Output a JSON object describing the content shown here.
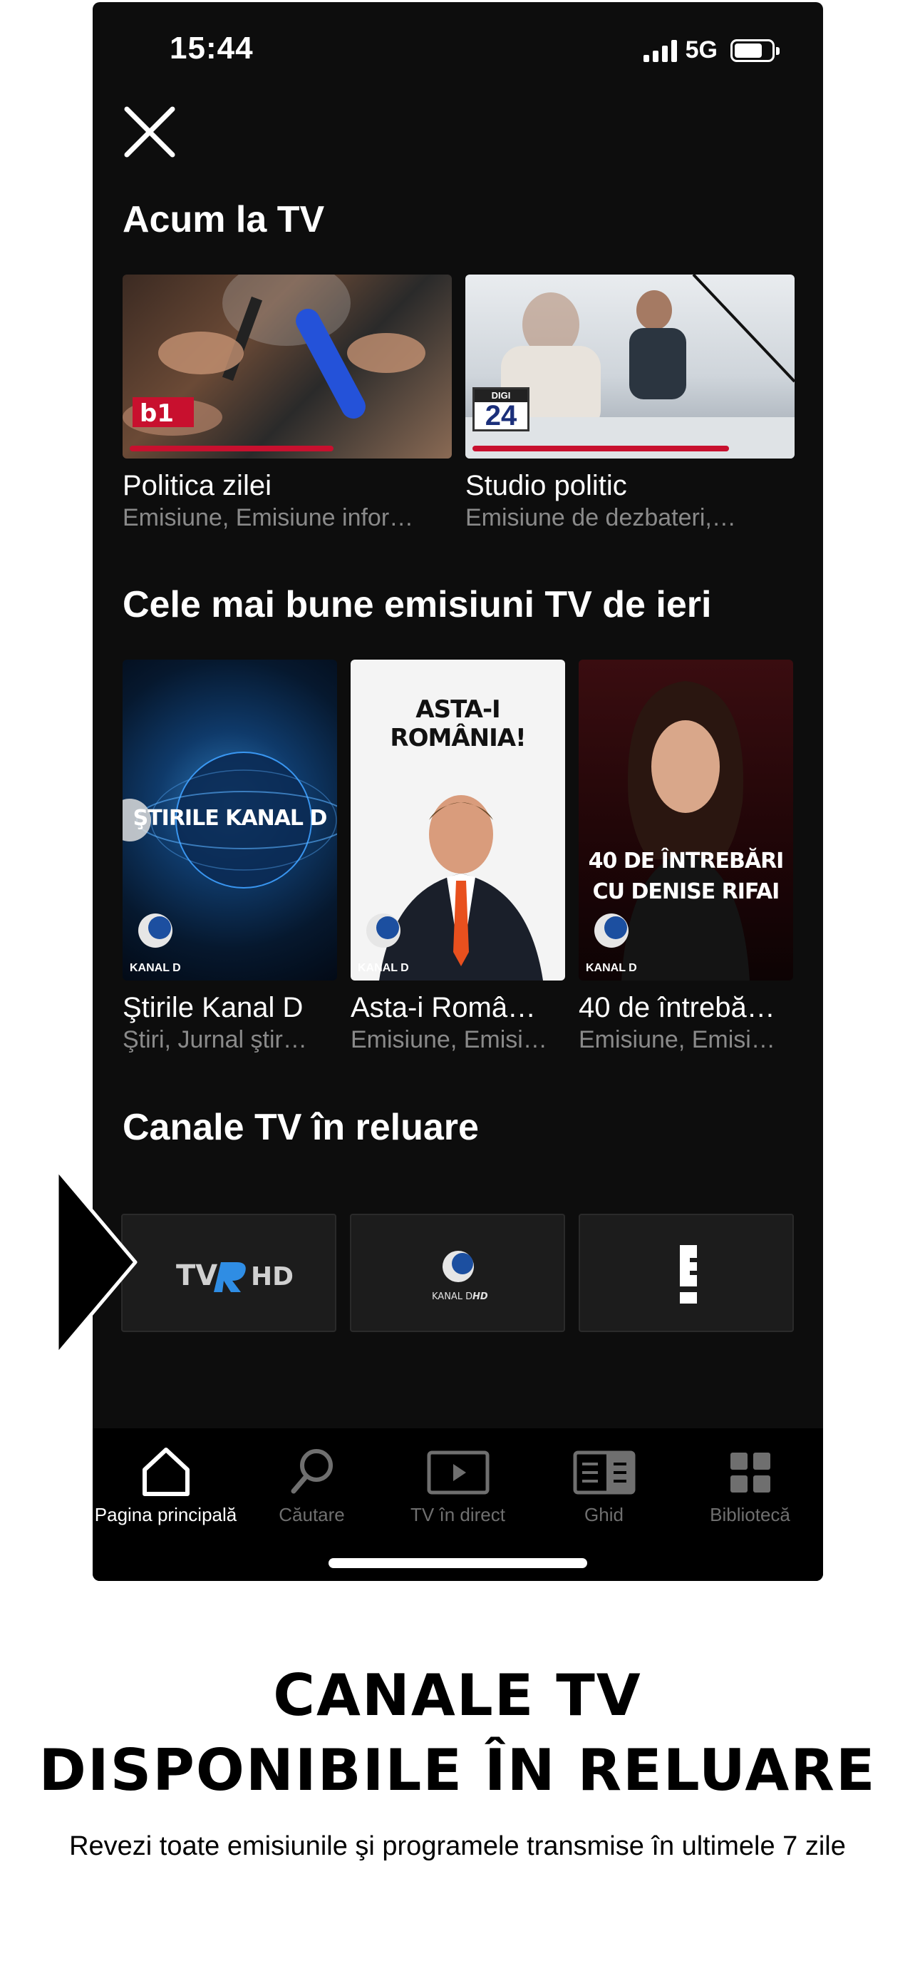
{
  "status_bar": {
    "time": "15:44",
    "network": "5G"
  },
  "sections": {
    "now_on_tv": {
      "title": "Acum la TV",
      "items": [
        {
          "title": "Politica zilei",
          "subtitle": "Emisiune, Emisiune infor…",
          "channel": "b1",
          "progress": 0.62
        },
        {
          "title": "Studio politic",
          "subtitle": "Emisiune de dezbateri,…",
          "channel": "DIGI 24",
          "progress": 0.78
        }
      ]
    },
    "best_yesterday": {
      "title": "Cele mai bune emisiuni TV de ieri",
      "items": [
        {
          "title": "Ştirile Kanal D",
          "subtitle": "Ştiri, Jurnal ştir…",
          "poster_text": "ŞTIRILE KANAL D",
          "channel": "KANAL D"
        },
        {
          "title": "Asta-i Româ…",
          "subtitle": "Emisiune, Emisi…",
          "poster_text": "ASTA-I ROMÂNIA!",
          "channel": "KANAL D"
        },
        {
          "title": "40 de întrebă…",
          "subtitle": "Emisiune, Emisi…",
          "poster_text_line1": "40 DE ÎNTREBĂRI",
          "poster_text_line2": "CU DENISE RIFAI",
          "channel": "KANAL D"
        }
      ]
    },
    "replay_channels": {
      "title": "Canale TV în reluare",
      "channels": [
        {
          "name": "TVR HD",
          "tvr": "TV",
          "hd": "HD"
        },
        {
          "name": "KANAL D HD",
          "label": "KANAL D",
          "hd": "HD"
        },
        {
          "name": "E!",
          "label": "E"
        }
      ]
    }
  },
  "tab_bar": {
    "tabs": [
      {
        "label": "Pagina principală",
        "icon": "home-icon",
        "active": true
      },
      {
        "label": "Căutare",
        "icon": "search-icon",
        "active": false
      },
      {
        "label": "TV în direct",
        "icon": "live-tv-icon",
        "active": false
      },
      {
        "label": "Ghid",
        "icon": "guide-icon",
        "active": false
      },
      {
        "label": "Bibliotecă",
        "icon": "library-icon",
        "active": false
      }
    ]
  },
  "promo": {
    "title_line1": "CANALE TV",
    "title_line2": "DISPONIBILE ÎN RELUARE",
    "subtitle": "Revezi toate emisiunile şi programele transmise în ultimele 7 zile"
  },
  "colors": {
    "accent": "#c8102e",
    "background": "#0d0d0d",
    "tile": "#1c1c1c"
  }
}
